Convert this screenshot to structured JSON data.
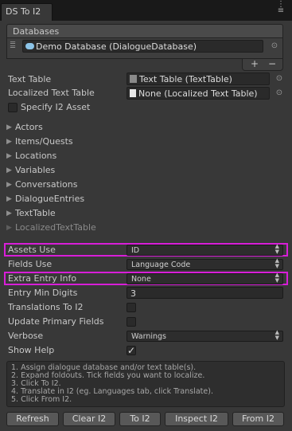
{
  "window": {
    "tab_title": "DS To I2",
    "menu_icon": "tab-menu-icon"
  },
  "databases": {
    "header": "Databases",
    "items": [
      {
        "value": "Demo Database (DialogueDatabase)"
      }
    ],
    "add_label": "+",
    "remove_label": "−"
  },
  "fields": {
    "text_table_label": "Text Table",
    "text_table_value": "Text Table (TextTable)",
    "localized_text_table_label": "Localized Text Table",
    "localized_text_table_value": "None (Localized Text Table)",
    "specify_i2_asset_label": "Specify I2 Asset"
  },
  "foldouts": [
    {
      "label": "Actors",
      "enabled": true
    },
    {
      "label": "Items/Quests",
      "enabled": true
    },
    {
      "label": "Locations",
      "enabled": true
    },
    {
      "label": "Variables",
      "enabled": true
    },
    {
      "label": "Conversations",
      "enabled": true
    },
    {
      "label": "DialogueEntries",
      "enabled": true
    },
    {
      "label": "TextTable",
      "enabled": true
    },
    {
      "label": "LocalizedTextTable",
      "enabled": false
    }
  ],
  "settings": {
    "assets_use_label": "Assets Use",
    "assets_use_value": "ID",
    "fields_use_label": "Fields Use",
    "fields_use_value": "Language Code",
    "extra_entry_info_label": "Extra Entry Info",
    "extra_entry_info_value": "None",
    "entry_min_digits_label": "Entry Min Digits",
    "entry_min_digits_value": "3",
    "translations_to_i2_label": "Translations To I2",
    "update_primary_fields_label": "Update Primary Fields",
    "verbose_label": "Verbose",
    "verbose_value": "Warnings",
    "show_help_label": "Show Help",
    "show_help_checked": true
  },
  "help": [
    "1. Assign dialogue database and/or text table(s).",
    "2. Expand foldouts. Tick fields you want to localize.",
    "3. Click To I2.",
    "4. Translate in I2 (eg. Languages tab, click Translate).",
    "5. Click From I2."
  ],
  "buttons": {
    "refresh": "Refresh",
    "clear_i2": "Clear I2",
    "to_i2": "To I2",
    "inspect_i2": "Inspect I2",
    "from_i2": "From I2"
  },
  "colors": {
    "highlight": "#d81ed8",
    "background": "#383838",
    "tab_bar": "#191919"
  }
}
